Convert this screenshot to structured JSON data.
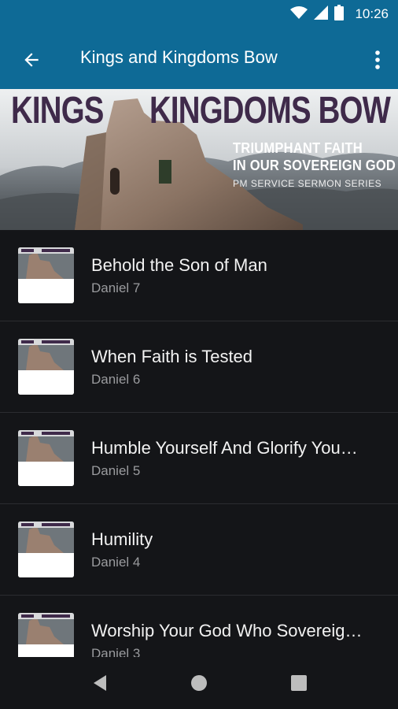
{
  "status_bar": {
    "time": "10:26"
  },
  "app_bar": {
    "title": "Kings and Kingdoms Bow"
  },
  "banner": {
    "title_left": "KINGS",
    "title_right": "KINGDOMS BOW",
    "subtitle_line1": "TRIUMPHANT FAITH",
    "subtitle_line2": "IN OUR SOVEREIGN GOD",
    "series_label": "PM SERVICE SERMON SERIES"
  },
  "sermons": [
    {
      "title": "Behold the Son of Man",
      "subtitle": "Daniel 7"
    },
    {
      "title": "When Faith is Tested",
      "subtitle": "Daniel 6"
    },
    {
      "title": "Humble Yourself And Glorify You…",
      "subtitle": "Daniel 5"
    },
    {
      "title": "Humility",
      "subtitle": "Daniel 4"
    },
    {
      "title": "Worship Your God Who Sovereig…",
      "subtitle": "Daniel 3"
    }
  ],
  "colors": {
    "app_bar": "#0e6a96",
    "background": "#141518",
    "banner_title": "#3f2a4a"
  }
}
